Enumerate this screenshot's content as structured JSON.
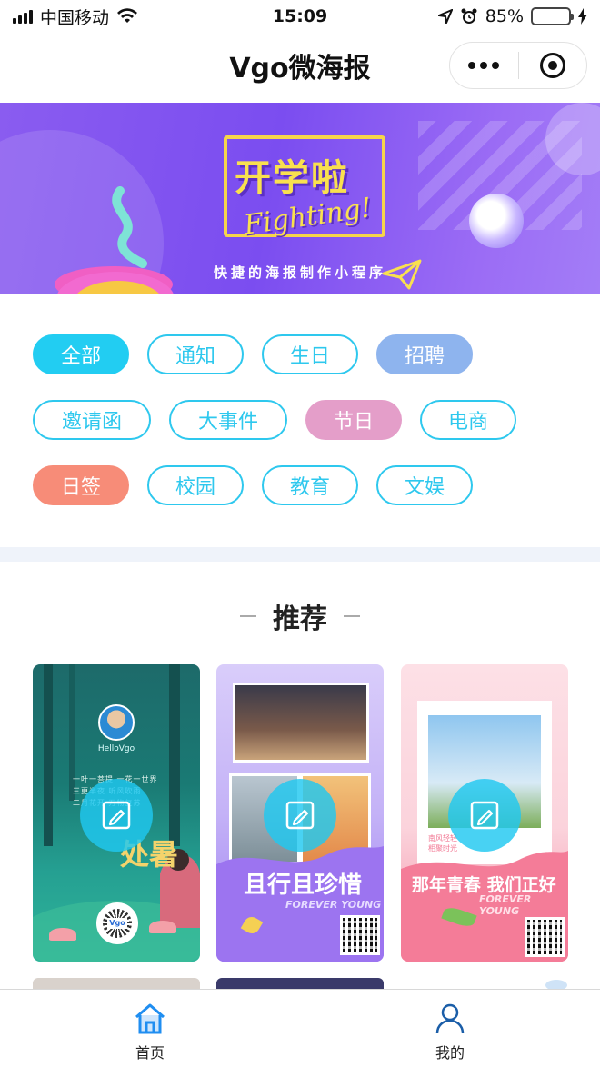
{
  "status_bar": {
    "carrier": "中国移动",
    "time": "15:09",
    "battery_percent": "85%",
    "battery_level": 0.85
  },
  "nav": {
    "title": "Vgo微海报",
    "more_icon": "more-dots-icon",
    "close_icon": "target-circle-icon"
  },
  "banner": {
    "headline": "开学啦",
    "script": "Fighting!",
    "subtitle": "快捷的海报制作小程序"
  },
  "tags": {
    "rows": [
      [
        {
          "label": "全部",
          "style": "filled-cyan"
        },
        {
          "label": "通知",
          "style": "outline"
        },
        {
          "label": "生日",
          "style": "outline"
        },
        {
          "label": "招聘",
          "style": "filled-blue"
        }
      ],
      [
        {
          "label": "邀请函",
          "style": "outline"
        },
        {
          "label": "大事件",
          "style": "outline"
        },
        {
          "label": "节日",
          "style": "filled-pink"
        },
        {
          "label": "电商",
          "style": "outline"
        }
      ],
      [
        {
          "label": "日签",
          "style": "filled-salmon"
        },
        {
          "label": "校园",
          "style": "outline"
        },
        {
          "label": "教育",
          "style": "outline"
        },
        {
          "label": "文娱",
          "style": "outline"
        }
      ]
    ]
  },
  "section": {
    "title": "推荐"
  },
  "cards": [
    {
      "poster_title": "处暑",
      "caption": "HelloVgo",
      "qr_label": "Vgo",
      "edit_icon": "edit-icon"
    },
    {
      "poster_title": "且行且珍惜",
      "caption": "FOREVER YOUNG",
      "edit_icon": "edit-icon"
    },
    {
      "poster_title": "那年青春 我们正好",
      "caption": "FOREVER YOUNG",
      "edit_icon": "edit-icon"
    }
  ],
  "tab_bar": {
    "home_label": "首页",
    "mine_label": "我的",
    "home_icon": "home-icon",
    "mine_icon": "user-icon",
    "active_color": "#1f8ef1"
  },
  "colors": {
    "accent_cyan": "#22cdf2",
    "tag_outline": "#2ec8ee"
  }
}
